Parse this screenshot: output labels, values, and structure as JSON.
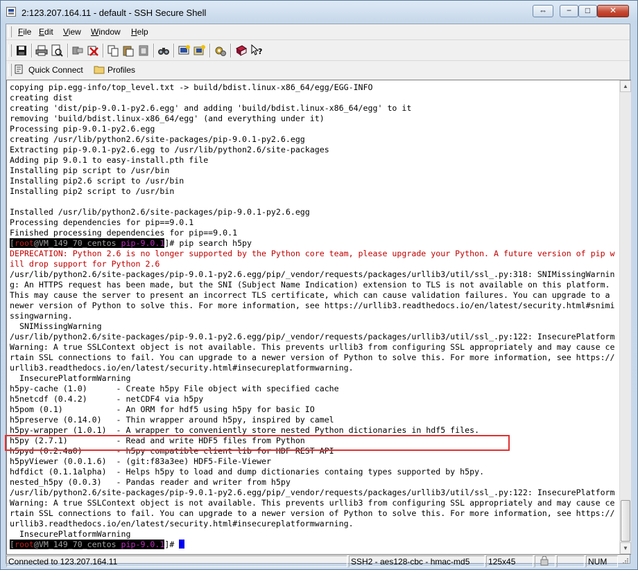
{
  "window": {
    "title": "2:123.207.164.11 - default - SSH Secure Shell",
    "extra_button_label": "⇔",
    "minimize_label": "−",
    "maximize_label": "□",
    "close_label": "✕"
  },
  "menu": {
    "items": [
      {
        "underline": "F",
        "rest": "ile"
      },
      {
        "underline": "E",
        "rest": "dit"
      },
      {
        "underline": "V",
        "rest": "iew"
      },
      {
        "underline": "W",
        "rest": "indow"
      },
      {
        "underline": "H",
        "rest": "elp"
      }
    ]
  },
  "toolbar": {
    "icons": [
      "save-icon",
      "print-icon",
      "print-preview-icon",
      "disconnect-icon",
      "delete-icon",
      "copy-icon",
      "paste-icon",
      "paste-all-icon",
      "find-icon",
      "new-terminal-icon",
      "new-file-transfer-icon",
      "settings-icon",
      "help-book-icon",
      "whats-this-icon"
    ]
  },
  "quickbar": {
    "quick_connect": "Quick Connect",
    "profiles": "Profiles"
  },
  "terminal": {
    "lines": [
      "copying pip.egg-info/top_level.txt -> build/bdist.linux-x86_64/egg/EGG-INFO",
      "creating dist",
      "creating 'dist/pip-9.0.1-py2.6.egg' and adding 'build/bdist.linux-x86_64/egg' to it",
      "removing 'build/bdist.linux-x86_64/egg' (and everything under it)",
      "Processing pip-9.0.1-py2.6.egg",
      "creating /usr/lib/python2.6/site-packages/pip-9.0.1-py2.6.egg",
      "Extracting pip-9.0.1-py2.6.egg to /usr/lib/python2.6/site-packages",
      "Adding pip 9.0.1 to easy-install.pth file",
      "Installing pip script to /usr/bin",
      "Installing pip2.6 script to /usr/bin",
      "Installing pip2 script to /usr/bin",
      "",
      "Installed /usr/lib/python2.6/site-packages/pip-9.0.1-py2.6.egg",
      "Processing dependencies for pip==9.0.1",
      "Finished processing dependencies for pip==9.0.1"
    ],
    "prompt1": {
      "open": "[",
      "user": "root",
      "host": "@VM_149_70_centos ",
      "dir": "pip-9.0.1",
      "close": "]",
      "command": "# pip search h5py"
    },
    "deprecation": [
      "DEPRECATION: Python 2.6 is no longer supported by the Python core team, please upgrade your Python. A future version of pip w",
      "ill drop support for Python 2.6"
    ],
    "output": [
      "/usr/lib/python2.6/site-packages/pip-9.0.1-py2.6.egg/pip/_vendor/requests/packages/urllib3/util/ssl_.py:318: SNIMissingWarnin",
      "g: An HTTPS request has been made, but the SNI (Subject Name Indication) extension to TLS is not available on this platform.",
      "This may cause the server to present an incorrect TLS certificate, which can cause validation failures. You can upgrade to a",
      "newer version of Python to solve this. For more information, see https://urllib3.readthedocs.io/en/latest/security.html#snimi",
      "ssingwarning.",
      "  SNIMissingWarning",
      "/usr/lib/python2.6/site-packages/pip-9.0.1-py2.6.egg/pip/_vendor/requests/packages/urllib3/util/ssl_.py:122: InsecurePlatform",
      "Warning: A true SSLContext object is not available. This prevents urllib3 from configuring SSL appropriately and may cause ce",
      "rtain SSL connections to fail. You can upgrade to a newer version of Python to solve this. For more information, see https://",
      "urllib3.readthedocs.io/en/latest/security.html#insecureplatformwarning.",
      "  InsecurePlatformWarning",
      "h5py-cache (1.0)      - Create h5py File object with specified cache",
      "h5netcdf (0.4.2)      - netCDF4 via h5py",
      "h5pom (0.1)           - An ORM for hdf5 using h5py for basic IO",
      "h5preserve (0.14.0)   - Thin wrapper around h5py, inspired by camel",
      "h5py-wrapper (1.0.1)  - A wrapper to conveniently store nested Python dictionaries in hdf5 files.",
      "h5py (2.7.1)          - Read and write HDF5 files from Python",
      "h5pyd (0.2.4a0)       - h5py compatible client lib for HDF REST API",
      "h5pyViewer (0.0.1.6)  - (git:f83a3ee) HDF5-File-Viewer",
      "hdfdict (0.1.1alpha)  - Helps h5py to load and dump dictionaries containg types supported by h5py.",
      "nested_h5py (0.0.3)   - Pandas reader and writer from h5py",
      "/usr/lib/python2.6/site-packages/pip-9.0.1-py2.6.egg/pip/_vendor/requests/packages/urllib3/util/ssl_.py:122: InsecurePlatform",
      "Warning: A true SSLContext object is not available. This prevents urllib3 from configuring SSL appropriately and may cause ce",
      "rtain SSL connections to fail. You can upgrade to a newer version of Python to solve this. For more information, see https://",
      "urllib3.readthedocs.io/en/latest/security.html#insecureplatformwarning.",
      "  InsecurePlatformWarning"
    ],
    "prompt2": {
      "open": "[",
      "user": "root",
      "host": "@VM_149_70_centos ",
      "dir": "pip-9.0.1",
      "close": "]",
      "command": "# "
    }
  },
  "statusbar": {
    "connection": "Connected to 123.207.164.11",
    "protocol": "SSH2 - aes128-cbc - hmac-md5",
    "size": "125x45",
    "numlock": "NUM"
  },
  "colors": {
    "highlight_box": "#e03030",
    "deprecation_text": "#c00000",
    "prompt_user": "#c02020",
    "prompt_dir": "#c02cc0",
    "cursor": "#0000ee"
  }
}
